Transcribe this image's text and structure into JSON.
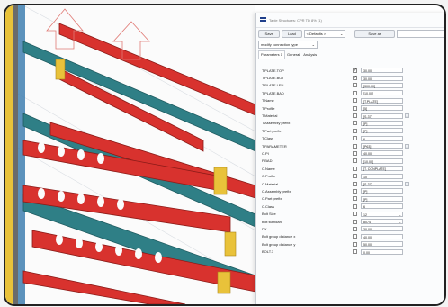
{
  "window": {
    "title": "Table Structures: CPR TD 8% (1)"
  },
  "toolbar": {
    "save_label": "Save",
    "load_label": "Load",
    "preset_value": "< Defaults >",
    "save_as_label": "Save as",
    "save_as_value": "",
    "filter_value": "modify connection type"
  },
  "tabs": [
    {
      "label": "Parameters 1"
    },
    {
      "label": "General"
    },
    {
      "label": "Analysis"
    }
  ],
  "params": [
    {
      "label": "T.PLATE.TOP",
      "checked": true,
      "value": "30.00"
    },
    {
      "label": "T.PLATE.BOT",
      "checked": true,
      "value": "30.00"
    },
    {
      "label": "T.PLATE.LEN",
      "checked": false,
      "value": "[300.00]"
    },
    {
      "label": "T.PLATE.BAD",
      "checked": false,
      "value": "[10.00]"
    },
    {
      "label": "T.Name",
      "checked": false,
      "value": "[T.PLATE]"
    },
    {
      "label": "T.Profile",
      "checked": false,
      "value": "[5]"
    },
    {
      "label": "T.Material",
      "checked": false,
      "value": "[S-37]"
    },
    {
      "label": "T.Assembly prefix",
      "checked": false,
      "value": "[P]"
    },
    {
      "label": "T.Part prefix",
      "checked": false,
      "value": "[P]"
    },
    {
      "label": "T.Class",
      "checked": false,
      "value": "6"
    },
    {
      "label": "T.PARAMETER",
      "checked": false,
      "value": "[P63]"
    },
    {
      "label": "C.PI",
      "checked": false,
      "value": "40.00"
    },
    {
      "label": "P.BAD",
      "checked": false,
      "value": "[10.00]"
    },
    {
      "label": "C.Name",
      "checked": false,
      "value": "[T. CONPLATE]"
    },
    {
      "label": "C.Profile",
      "checked": false,
      "value": "10"
    },
    {
      "label": "C.Material",
      "checked": false,
      "value": "[S-37]"
    },
    {
      "label": "C.Assembly prefix",
      "checked": false,
      "value": "[P]"
    },
    {
      "label": "C.Part prefix",
      "checked": false,
      "value": "[P]"
    },
    {
      "label": "C.Class",
      "checked": false,
      "value": "6"
    },
    {
      "label": "Bolt Size",
      "checked": false,
      "value": "12"
    },
    {
      "label": "bolt standard",
      "checked": false,
      "value": "8074"
    },
    {
      "label": "DX",
      "checked": false,
      "value": "30.00"
    },
    {
      "label": "Bolt group distance x",
      "checked": false,
      "value": "40.00"
    },
    {
      "label": "Bolt group distance y",
      "checked": false,
      "value": "50.00"
    },
    {
      "label": "BOLT.3",
      "checked": false,
      "value": "0.00"
    }
  ],
  "colors": {
    "beam_red": "#d8322e",
    "beam_teal": "#2f7f86",
    "plate_yellow": "#e9c23a",
    "column_blue": "#3f7fb0",
    "dialog_bg": "#fbfcfd"
  }
}
